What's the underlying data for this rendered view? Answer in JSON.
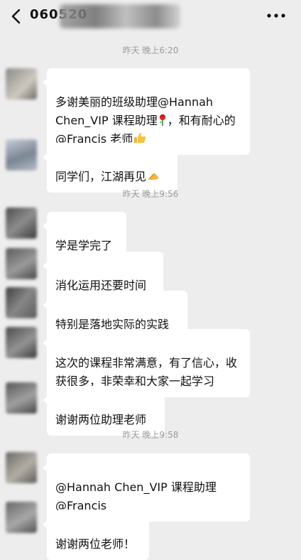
{
  "header": {
    "title": "060520"
  },
  "messages": [
    {
      "kind": "time",
      "text": "昨天 晚上6:20"
    },
    {
      "kind": "msg",
      "text": "多谢美丽的班级助理@Hannah Chen_VIP 课程助理",
      "text2": "，和有耐心的@Francis 老师"
    },
    {
      "kind": "msg",
      "text": "同学们，江湖再见"
    },
    {
      "kind": "time",
      "text": "昨天 晚上9:56"
    },
    {
      "kind": "msg",
      "text": "学是学完了"
    },
    {
      "kind": "msg",
      "text": "消化运用还要时间"
    },
    {
      "kind": "msg",
      "text": "特别是落地实际的实践"
    },
    {
      "kind": "msg",
      "text": "这次的课程非常满意，有了信心，收获很多，非荣幸和大家一起学习"
    },
    {
      "kind": "msg",
      "text": "谢谢两位助理老师"
    },
    {
      "kind": "time",
      "text": "昨天 晚上9:58"
    },
    {
      "kind": "msg",
      "text": "@Hannah Chen_VIP 课程助理 @Francis"
    },
    {
      "kind": "msg",
      "text": "谢谢两位老师！"
    }
  ],
  "icons": {
    "back": "chevron-left-icon",
    "more": "more-dots-icon",
    "rose": "rose-icon",
    "thumbs": "thumbs-up-icon",
    "fist": "salute-fist-icon"
  },
  "colors": {
    "background": "#ededed",
    "bubble": "#ffffff",
    "timestamp": "#9b9b9b"
  }
}
